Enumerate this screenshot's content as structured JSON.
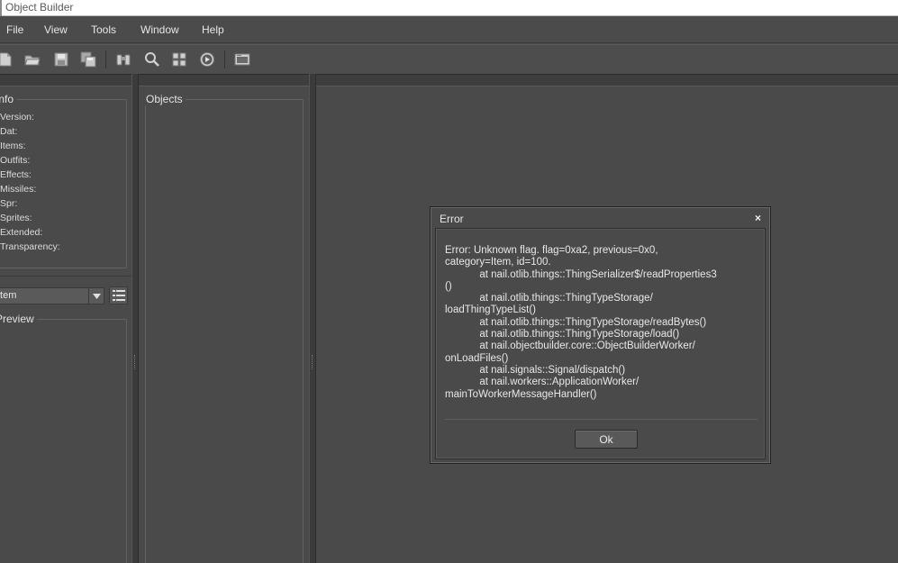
{
  "window": {
    "title": "Object Builder"
  },
  "menu": [
    {
      "label": "File"
    },
    {
      "label": "View"
    },
    {
      "label": "Tools"
    },
    {
      "label": "Window"
    },
    {
      "label": "Help"
    }
  ],
  "toolbar": {
    "icons": [
      "new-file-icon",
      "open-folder-icon",
      "save-icon",
      "save-all-icon",
      "binoculars-icon",
      "search-icon",
      "sprites-grid-icon",
      "play-animation-icon",
      "image-viewer-icon"
    ]
  },
  "info_panel": {
    "legend": "Info",
    "rows": [
      {
        "label": "Version:"
      },
      {
        "label": "Dat:"
      },
      {
        "label": "Items:"
      },
      {
        "label": "Outfits:"
      },
      {
        "label": "Effects:"
      },
      {
        "label": "Missiles:"
      },
      {
        "label": "Spr:"
      },
      {
        "label": "Sprites:"
      },
      {
        "label": "Extended:"
      },
      {
        "label": "Transparency:"
      }
    ],
    "category_select": "Item",
    "preview_legend": "Preview"
  },
  "objects_panel": {
    "legend": "Objects"
  },
  "error_dialog": {
    "title": "Error",
    "close": "×",
    "message": "Error: Unknown flag. flag=0xa2, previous=0x0,\ncategory=Item, id=100.\n            at nail.otlib.things::ThingSerializer$/readProperties3\n()\n            at nail.otlib.things::ThingTypeStorage/\nloadThingTypeList()\n            at nail.otlib.things::ThingTypeStorage/readBytes()\n            at nail.otlib.things::ThingTypeStorage/load()\n            at nail.objectbuilder.core::ObjectBuilderWorker/\nonLoadFiles()\n            at nail.signals::Signal/dispatch()\n            at nail.workers::ApplicationWorker/\nmainToWorkerMessageHandler()",
    "ok_label": "Ok"
  },
  "colors": {
    "background": "#4c4c4c",
    "text": "#e0e0e0"
  }
}
